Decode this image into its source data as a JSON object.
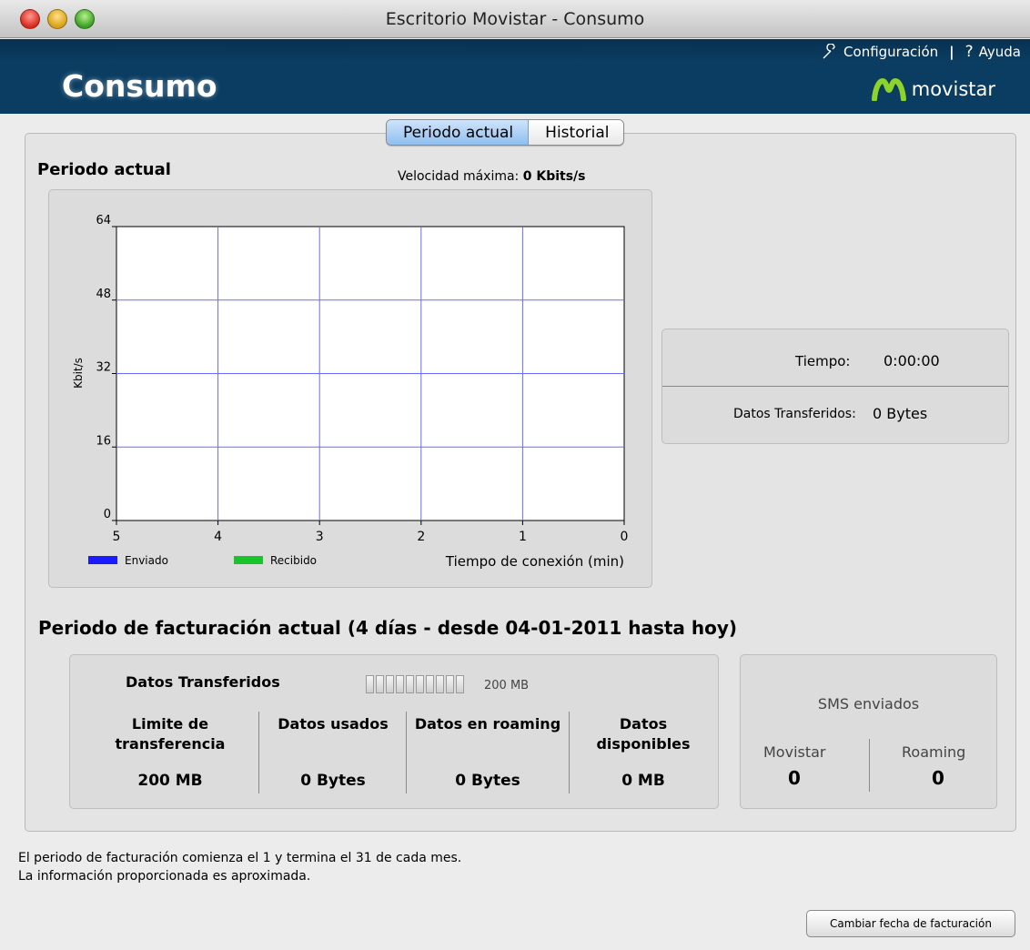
{
  "window": {
    "title": "Escritorio Movistar  - Consumo"
  },
  "header": {
    "config_label": "Configuración",
    "separator": "|",
    "help_glyph": "?",
    "help_label": "Ayuda",
    "heading": "Consumo",
    "brand": "movistar"
  },
  "tabs": {
    "active": "Periodo actual",
    "inactive": "Historial"
  },
  "current": {
    "title": "Periodo actual",
    "max_speed_label": "Velocidad máxima:",
    "max_speed_value": "0 Kbits/s"
  },
  "chart_data": {
    "type": "line",
    "title": "",
    "xlabel": "Tiempo de conexión (min)",
    "ylabel": "Kbit/s",
    "x_ticks": [
      5,
      4,
      3,
      2,
      1,
      0
    ],
    "y_ticks": [
      0,
      16,
      32,
      48,
      64
    ],
    "xlim": [
      5,
      0
    ],
    "ylim": [
      0,
      64
    ],
    "grid": true,
    "series": [
      {
        "name": "Enviado",
        "color": "#1a1aff",
        "values": []
      },
      {
        "name": "Recibido",
        "color": "#18c42a",
        "values": []
      }
    ]
  },
  "stats": {
    "time_label": "Tiempo:",
    "time_value": "0:00:00",
    "data_label": "Datos Transferidos:",
    "data_value": "0 Bytes"
  },
  "billing": {
    "title": "Periodo de facturación actual (4 días - desde 04-01-2011 hasta hoy)",
    "transferred_label": "Datos Transferidos",
    "meter_caption": "200 MB",
    "meter_fill": 0,
    "limit_label_1": "Limite de",
    "limit_label_2": "transferencia",
    "limit_value": "200 MB",
    "used_label": "Datos usados",
    "used_value": "0 Bytes",
    "roaming_label": "Datos en roaming",
    "roaming_value": "0 Bytes",
    "available_label_1": "Datos",
    "available_label_2": "disponibles",
    "available_value": "0 MB"
  },
  "sms": {
    "title": "SMS enviados",
    "movistar_label": "Movistar",
    "movistar_value": "0",
    "roaming_label": "Roaming",
    "roaming_value": "0"
  },
  "footer": {
    "line1": "El periodo de facturación comienza el 1 y termina el 31 de cada mes.",
    "line2": "La información proporcionada es aproximada.",
    "button": "Cambiar fecha de facturación"
  }
}
